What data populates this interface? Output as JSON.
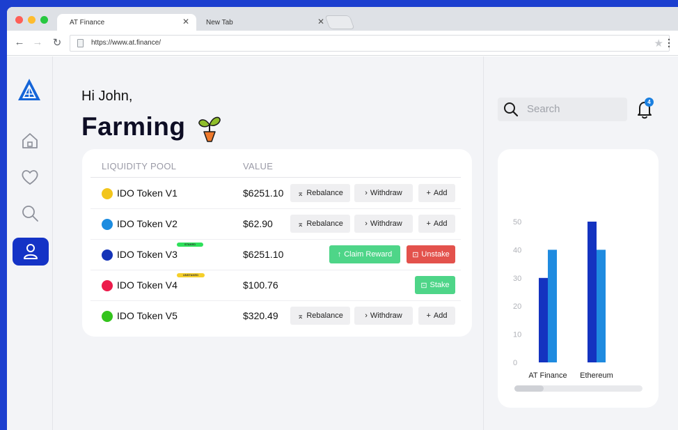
{
  "browser": {
    "tabs": [
      {
        "label": "AT Finance",
        "active": true
      },
      {
        "label": "New Tab",
        "active": false
      }
    ],
    "url": "https://www.at.finance/"
  },
  "sidebar": {
    "items": [
      "home",
      "favorites",
      "search",
      "profile"
    ],
    "active": "profile"
  },
  "main": {
    "greeting": "Hi John,",
    "title": "Farming",
    "columns": [
      "LIQUIDITY POOL",
      "VALUE"
    ],
    "rows": [
      {
        "name": "IDO Token V1",
        "color": "#f2c51b",
        "value": "$6251.10",
        "badge": "",
        "actions": [
          "Rebalance",
          "Withdraw",
          "Add"
        ]
      },
      {
        "name": "IDO Token V2",
        "color": "#1c8ce0",
        "value": "$62.90",
        "badge": "",
        "actions": [
          "Rebalance",
          "Withdraw",
          "Add"
        ]
      },
      {
        "name": "IDO Token V3",
        "color": "#1534b8",
        "value": "$6251.10",
        "badge": "STAKED",
        "badge_color": "#2ee05a",
        "actions": [
          "Claim Reward",
          "Unstake"
        ]
      },
      {
        "name": "IDO Token V4",
        "color": "#ec1b4b",
        "value": "$100.76",
        "badge": "UNSTAKED",
        "badge_color": "#f5cf2a",
        "actions": [
          "Stake"
        ]
      },
      {
        "name": "IDO Token V5",
        "color": "#33c41c",
        "value": "$320.49",
        "badge": "",
        "actions": [
          "Rebalance",
          "Withdraw",
          "Add"
        ]
      }
    ]
  },
  "right": {
    "search_placeholder": "Search",
    "notification_count": "4"
  },
  "chart_data": {
    "type": "bar",
    "categories": [
      "AT Finance",
      "Ethereum"
    ],
    "series": [
      {
        "color": "#1433c0",
        "values": [
          30,
          50
        ]
      },
      {
        "color": "#1f8be0",
        "values": [
          40,
          40
        ]
      }
    ],
    "yticks": [
      "0",
      "10",
      "20",
      "30",
      "40",
      "50"
    ],
    "ylim": [
      0,
      50
    ]
  }
}
